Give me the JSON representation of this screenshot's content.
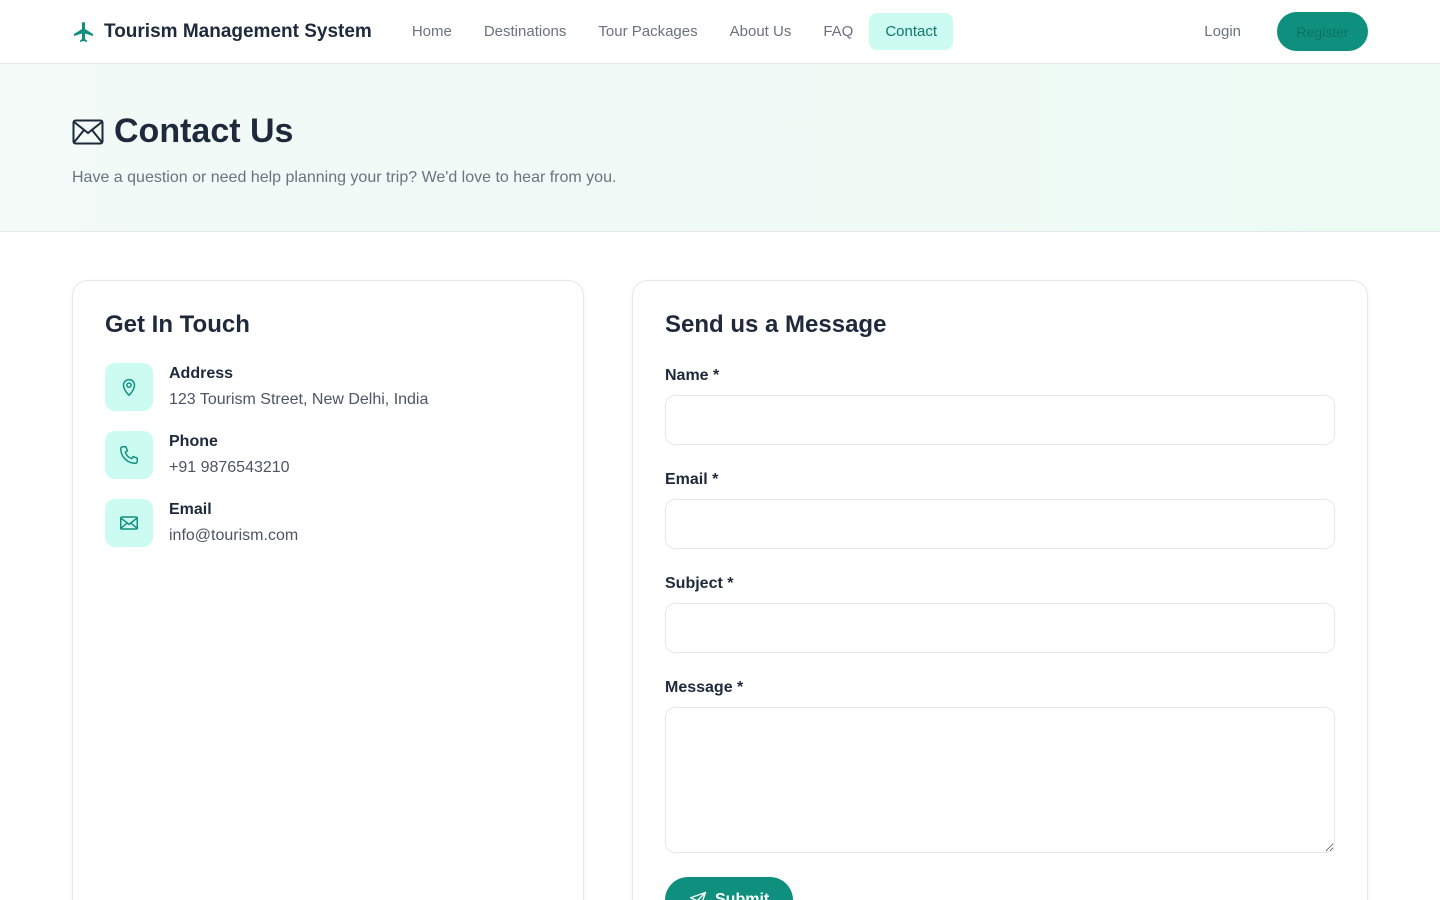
{
  "navbar": {
    "brand": "Tourism Management System",
    "links": [
      "Home",
      "Destinations",
      "Tour Packages",
      "About Us",
      "FAQ",
      "Contact"
    ],
    "active": "Contact",
    "login": "Login",
    "register": "Register"
  },
  "hero": {
    "title": "Contact Us",
    "subtitle": "Have a question or need help planning your trip? We'd love to hear from you."
  },
  "contact_info": {
    "title": "Get In Touch",
    "items": [
      {
        "label": "Address",
        "value": "123 Tourism Street, New Delhi, India",
        "icon": "map-pin-icon"
      },
      {
        "label": "Phone",
        "value": "+91 9876543210",
        "icon": "phone-icon"
      },
      {
        "label": "Email",
        "value": "info@tourism.com",
        "icon": "mail-icon"
      }
    ]
  },
  "form": {
    "title": "Send us a Message",
    "name_label": "Name *",
    "name_value": "",
    "email_label": "Email *",
    "email_value": "",
    "subject_label": "Subject *",
    "subject_value": "",
    "message_label": "Message *",
    "message_value": "",
    "submit": "Submit"
  },
  "colors": {
    "accent": "#0f8f7e",
    "accent_light": "#ccfbf1",
    "text_dark": "#1e293b",
    "text_muted": "#6b7280"
  }
}
